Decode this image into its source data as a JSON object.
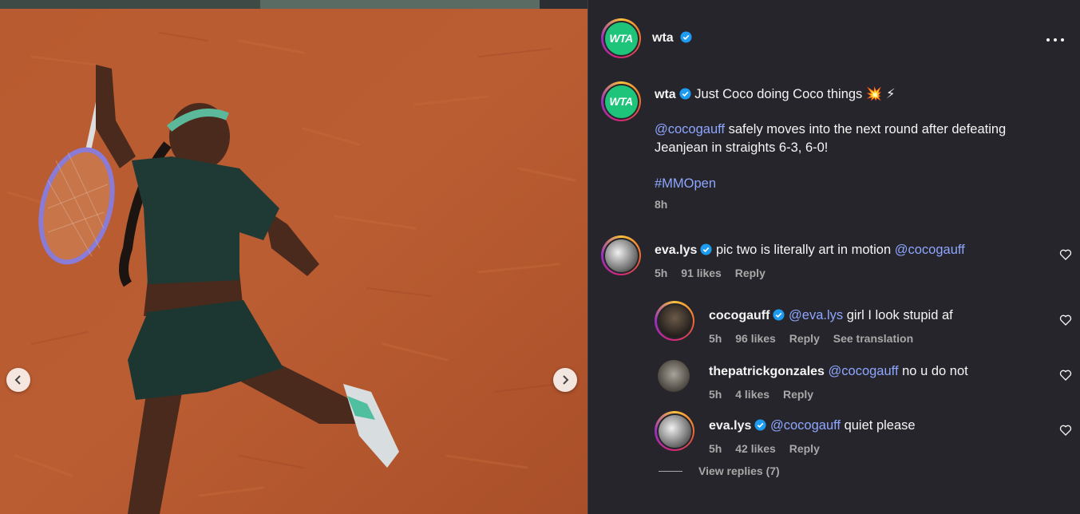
{
  "post": {
    "author": "wta",
    "caption": {
      "text": "Just Coco doing Coco things 💥 ⚡",
      "body_mention": "@cocogauff",
      "body_text": " safely moves into the next round after defeating Jeanjean in straights 6-3, 6-0!",
      "hashtag": "#MMOpen",
      "time": "8h"
    },
    "avatar_text": "WTA"
  },
  "comments": [
    {
      "user": "eva.lys",
      "verified": true,
      "text": "pic two is literally art in motion ",
      "mention_after": "@cocogauff",
      "time": "5h",
      "likes": "91 likes",
      "reply": "Reply"
    },
    {
      "user": "cocogauff",
      "verified": true,
      "mention_before": "@eva.lys",
      "text": " girl I look stupid af",
      "time": "5h",
      "likes": "96 likes",
      "reply": "Reply",
      "translate": "See translation"
    },
    {
      "user": "thepatrickgonzales",
      "verified": false,
      "mention_before": "@cocogauff",
      "text": " no u do not",
      "time": "5h",
      "likes": "4 likes",
      "reply": "Reply"
    },
    {
      "user": "eva.lys",
      "verified": true,
      "mention_before": "@cocogauff",
      "text": " quiet please",
      "time": "5h",
      "likes": "42 likes",
      "reply": "Reply"
    }
  ],
  "view_replies": "View replies (7)",
  "colors": {
    "background": "#25252b",
    "accent_link": "#8ea6ff",
    "verified": "#1d9bf0",
    "wta_green": "#1ec47a",
    "clay": "#b5582f"
  },
  "icons": {
    "prev": "chevron-left-icon",
    "next": "chevron-right-icon",
    "more": "more-horizontal-icon",
    "heart": "heart-icon",
    "verified": "verified-badge-icon"
  }
}
